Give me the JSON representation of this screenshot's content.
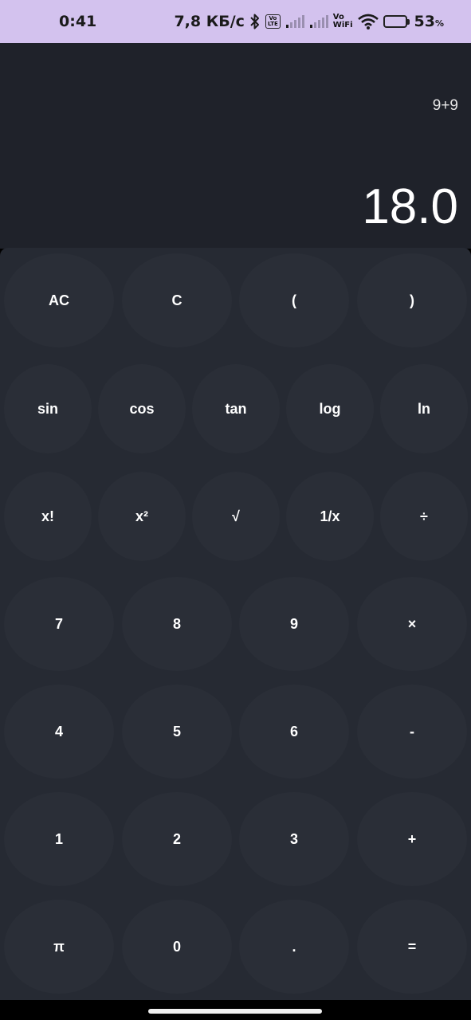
{
  "status_bar": {
    "time": "0:41",
    "net_speed": "7,8 КБ/с",
    "volte_label": "Vo\nLTE",
    "vowifi_label": "Vo\nWiFi",
    "battery_pct": "53",
    "battery_pct_sign": "%",
    "battery_level": 0.53
  },
  "display": {
    "expression": "9+9",
    "result": "18.0"
  },
  "keypad": {
    "row1": [
      "AC",
      "C",
      "(",
      ")"
    ],
    "row2": [
      "sin",
      "cos",
      "tan",
      "log",
      "ln"
    ],
    "row3": [
      "x!",
      "x²",
      "√",
      "1/x",
      "÷"
    ],
    "row4": [
      "7",
      "8",
      "9",
      "×"
    ],
    "row5": [
      "4",
      "5",
      "6",
      "-"
    ],
    "row6": [
      "1",
      "2",
      "3",
      "+"
    ],
    "row7": [
      "π",
      "0",
      ".",
      "="
    ]
  },
  "colors": {
    "status_bar_bg": "#d3c2ee",
    "display_bg": "#1f222a",
    "keypad_bg": "#262a33",
    "key_bg": "#2a2e37",
    "text": "#ffffff"
  }
}
